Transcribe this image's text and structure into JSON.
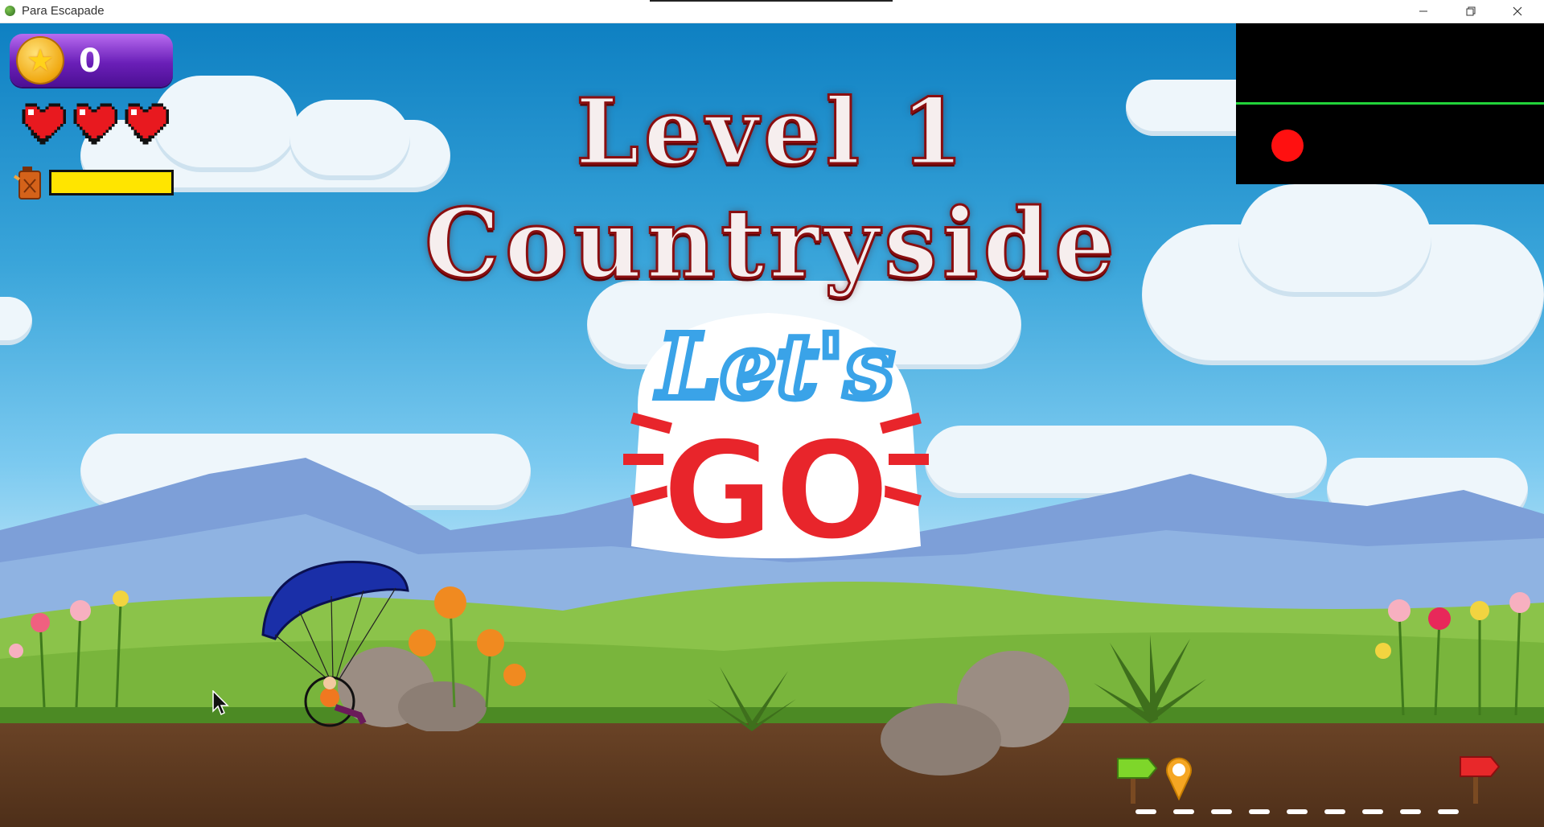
{
  "window": {
    "title": "Para Escapade",
    "controls": [
      "minimize",
      "restore",
      "close"
    ]
  },
  "hud": {
    "coins": "0",
    "lives": 3,
    "fuel_level": 1.0,
    "icons": {
      "coin": "star-coin-icon",
      "life": "heart-icon",
      "fuel": "fuel-can-icon"
    }
  },
  "level": {
    "title": "Level 1",
    "subtitle": "Countryside",
    "banner_top": "Let's",
    "banner_bottom": "GO"
  },
  "minimap": {
    "background": "#000000",
    "line_color": "#22d33a",
    "player_color": "#ff1010"
  },
  "progress": {
    "start_flag_color": "#7ed62a",
    "end_flag_color": "#e8282a",
    "marker_color": "#f5a623",
    "position": 0.06
  }
}
